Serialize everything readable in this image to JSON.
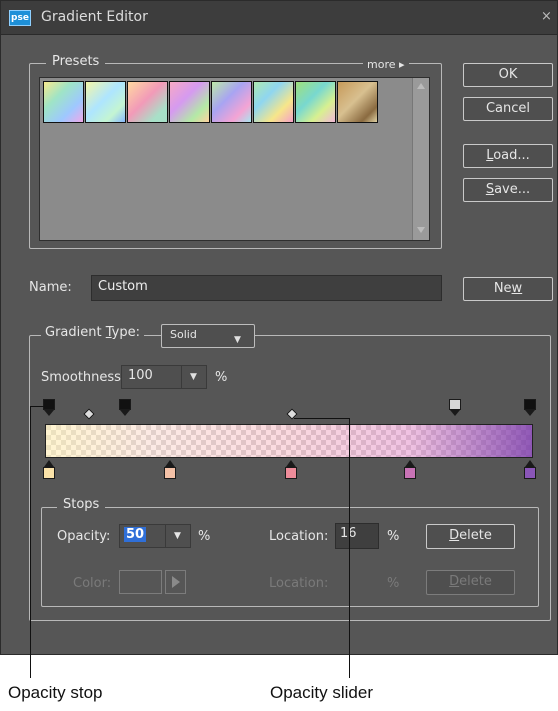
{
  "window": {
    "title": "Gradient Editor",
    "app_icon_text": "pse",
    "close_glyph": "×"
  },
  "presets": {
    "legend": "Presets",
    "more_label": "more",
    "swatches": [
      "linear-gradient(135deg,#f7e98e,#9fe4c6 35%,#9ec8ff 70%,#f0a8e8)",
      "linear-gradient(135deg,#f3f6a8,#aee5ff 45%,#c4f5d2 75%,#88b8ff)",
      "linear-gradient(135deg,#ffd9a0,#f29ab8 45%,#a8e0c8 80%)",
      "linear-gradient(135deg,#f7a9c4,#d59af0 40%,#b3e9a6 75%,#ffd2a0)",
      "linear-gradient(135deg,#bde9a8,#a8a4f2 40%,#f4a4d4 75%,#a6e6f0)",
      "linear-gradient(135deg,#aee8b0,#8fd6f0 35%,#f7e68a 70%,#f6a0c8)",
      "linear-gradient(135deg,#9fe07a,#78d8d0 40%,#d8f090 70%,#f2b8d8)",
      "linear-gradient(135deg,#c79a5a,#d8c090 45%,#8a6a40 80%,#e0d2a4)"
    ]
  },
  "buttons": {
    "ok": "OK",
    "cancel": "Cancel",
    "load": "Load...",
    "save": "Save...",
    "new": "New",
    "delete": "Delete"
  },
  "name": {
    "label": "Name:",
    "value": "Custom"
  },
  "gradient": {
    "type_label": "Gradient Type:",
    "type_value": "Solid",
    "smoothness_label": "Smoothness:",
    "smoothness_value": "100",
    "smoothness_unit": "%",
    "opacity_stop_colors": [
      "#111111",
      "#111111",
      "#d8d8d8",
      "#111111"
    ],
    "color_stop_colors": [
      "#fbe3a9",
      "#f4c1a7",
      "#ee8c9a",
      "#c873b5",
      "#8a56b8"
    ]
  },
  "stops": {
    "legend": "Stops",
    "opacity_label": "Opacity:",
    "opacity_value": "50",
    "opacity_unit": "%",
    "location_label": "Location:",
    "location_value": "16",
    "location_unit": "%",
    "color_label": "Color:",
    "location2_label": "Location:",
    "location2_unit": "%"
  },
  "callouts": {
    "opacity_stop": "Opacity stop",
    "opacity_slider": "Opacity slider"
  },
  "colors": {
    "dialog_bg": "#565656",
    "titlebar_bg": "#3d3d3d",
    "accent_selection": "#2f6fd8"
  }
}
